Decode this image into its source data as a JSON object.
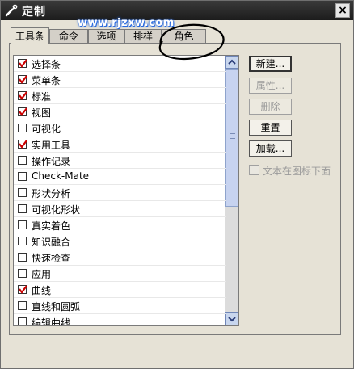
{
  "window": {
    "title": "定制"
  },
  "watermark": "www.rjzxw.com",
  "tabs": [
    {
      "label": "工具条",
      "active": true
    },
    {
      "label": "命令",
      "active": false
    },
    {
      "label": "选项",
      "active": false
    },
    {
      "label": "排样",
      "active": false
    },
    {
      "label": "角色",
      "active": false
    }
  ],
  "toolbar_list": [
    {
      "label": "选择条",
      "checked": true
    },
    {
      "label": "菜单条",
      "checked": true
    },
    {
      "label": "标准",
      "checked": true
    },
    {
      "label": "视图",
      "checked": true
    },
    {
      "label": "可视化",
      "checked": false
    },
    {
      "label": "实用工具",
      "checked": true
    },
    {
      "label": "操作记录",
      "checked": false
    },
    {
      "label": "Check-Mate",
      "checked": false
    },
    {
      "label": "形状分析",
      "checked": false
    },
    {
      "label": "可视化形状",
      "checked": false
    },
    {
      "label": "真实着色",
      "checked": false
    },
    {
      "label": "知识融合",
      "checked": false
    },
    {
      "label": "快速检查",
      "checked": false
    },
    {
      "label": "应用",
      "checked": false
    },
    {
      "label": "曲线",
      "checked": true
    },
    {
      "label": "直线和圆弧",
      "checked": false
    },
    {
      "label": "编辑曲线",
      "checked": false
    }
  ],
  "buttons": {
    "new": "新建...",
    "properties": "属性...",
    "delete": "删除",
    "reset": "重置",
    "load": "加载..."
  },
  "options": {
    "text_below_icon": "文本在图标下面"
  },
  "colors": {
    "check_red": "#cc0000",
    "annotation": "#000000"
  }
}
